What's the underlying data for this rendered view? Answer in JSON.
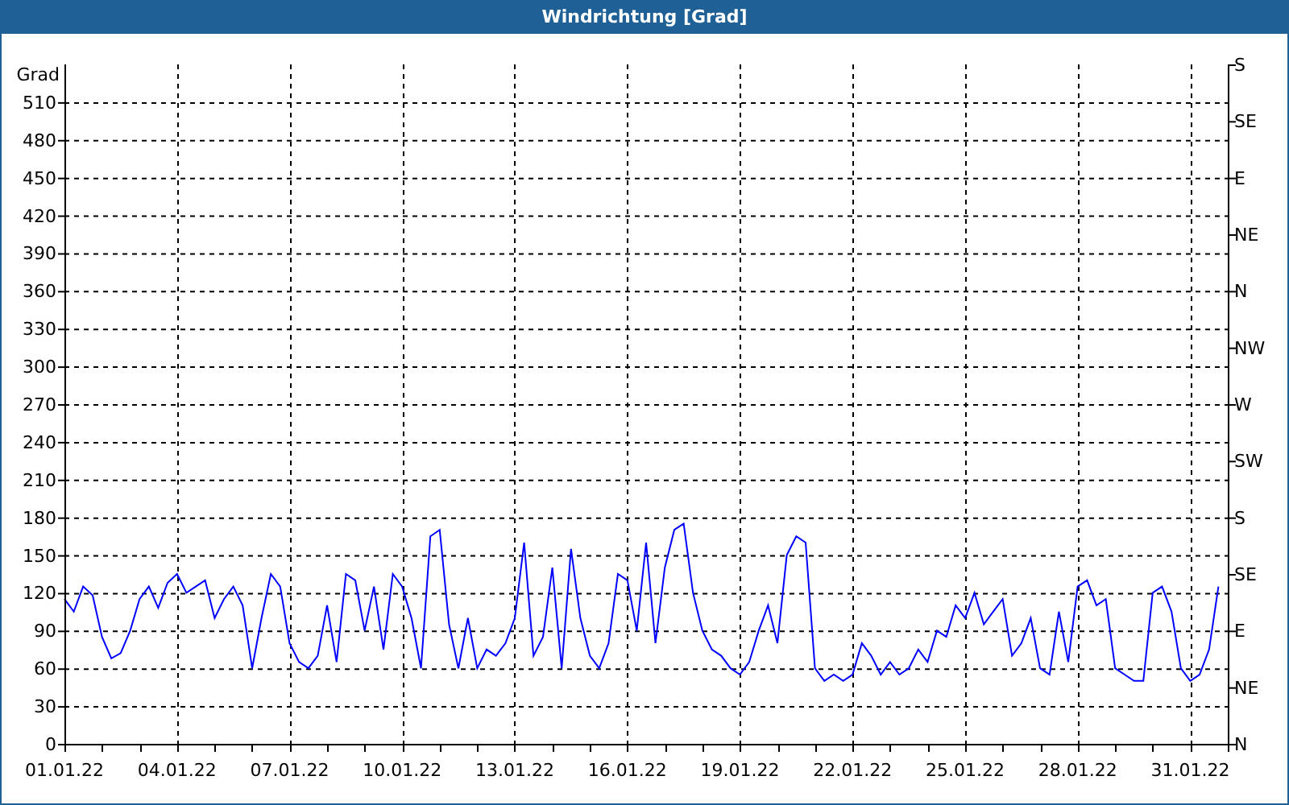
{
  "window": {
    "title": "Windrichtung [Grad]"
  },
  "chart": {
    "chart_data": {
      "type": "line",
      "grid": true,
      "ylabel": "Grad",
      "ylim": [
        0,
        540
      ],
      "yticks": [
        0,
        30,
        60,
        90,
        120,
        150,
        180,
        210,
        240,
        270,
        300,
        330,
        360,
        390,
        420,
        450,
        480,
        510
      ],
      "categories": [
        "01.01.22",
        null,
        null,
        null,
        null,
        null,
        null,
        null,
        null,
        null,
        null,
        null,
        "04.01.22",
        null,
        null,
        null,
        null,
        null,
        null,
        null,
        null,
        null,
        null,
        null,
        "07.01.22",
        null,
        null,
        null,
        null,
        null,
        null,
        null,
        null,
        null,
        null,
        null,
        "10.01.22",
        null,
        null,
        null,
        null,
        null,
        null,
        null,
        null,
        null,
        null,
        null,
        "13.01.22",
        null,
        null,
        null,
        null,
        null,
        null,
        null,
        null,
        null,
        null,
        null,
        "16.01.22",
        null,
        null,
        null,
        null,
        null,
        null,
        null,
        null,
        null,
        null,
        null,
        "19.01.22",
        null,
        null,
        null,
        null,
        null,
        null,
        null,
        null,
        null,
        null,
        null,
        "22.01.22",
        null,
        null,
        null,
        null,
        null,
        null,
        null,
        null,
        null,
        null,
        null,
        "25.01.22",
        null,
        null,
        null,
        null,
        null,
        null,
        null,
        null,
        null,
        null,
        null,
        "28.01.22",
        null,
        null,
        null,
        null,
        null,
        null,
        null,
        null,
        null,
        null,
        null,
        "31.01.22",
        null,
        null,
        null,
        null
      ],
      "series": [
        {
          "color": "#0000ff",
          "values": [
            115,
            105,
            125,
            118,
            85,
            68,
            72,
            90,
            115,
            125,
            108,
            128,
            135,
            120,
            125,
            130,
            100,
            115,
            125,
            110,
            60,
            100,
            135,
            125,
            80,
            65,
            60,
            70,
            110,
            65,
            135,
            130,
            90,
            125,
            75,
            135,
            125,
            100,
            60,
            165,
            170,
            95,
            60,
            100,
            60,
            75,
            70,
            80,
            100,
            160,
            70,
            85,
            140,
            60,
            155,
            100,
            70,
            60,
            80,
            135,
            130,
            90,
            160,
            80,
            140,
            170,
            175,
            120,
            90,
            75,
            70,
            60,
            55,
            65,
            90,
            110,
            80,
            150,
            165,
            160,
            60,
            50,
            55,
            50,
            55,
            80,
            70,
            55,
            65,
            55,
            60,
            75,
            65,
            90,
            85,
            110,
            100,
            120,
            95,
            105,
            115,
            70,
            80,
            100,
            60,
            55,
            105,
            65,
            125,
            130,
            110,
            115,
            60,
            55,
            50,
            50,
            120,
            125,
            105,
            60,
            50,
            55,
            75,
            125,
            null
          ]
        }
      ]
    },
    "right_axis_labels": [
      "S",
      "SE",
      "E",
      "NE",
      "N",
      "NW",
      "W",
      "SW",
      "S",
      "SE",
      "E",
      "NE",
      "N"
    ]
  }
}
